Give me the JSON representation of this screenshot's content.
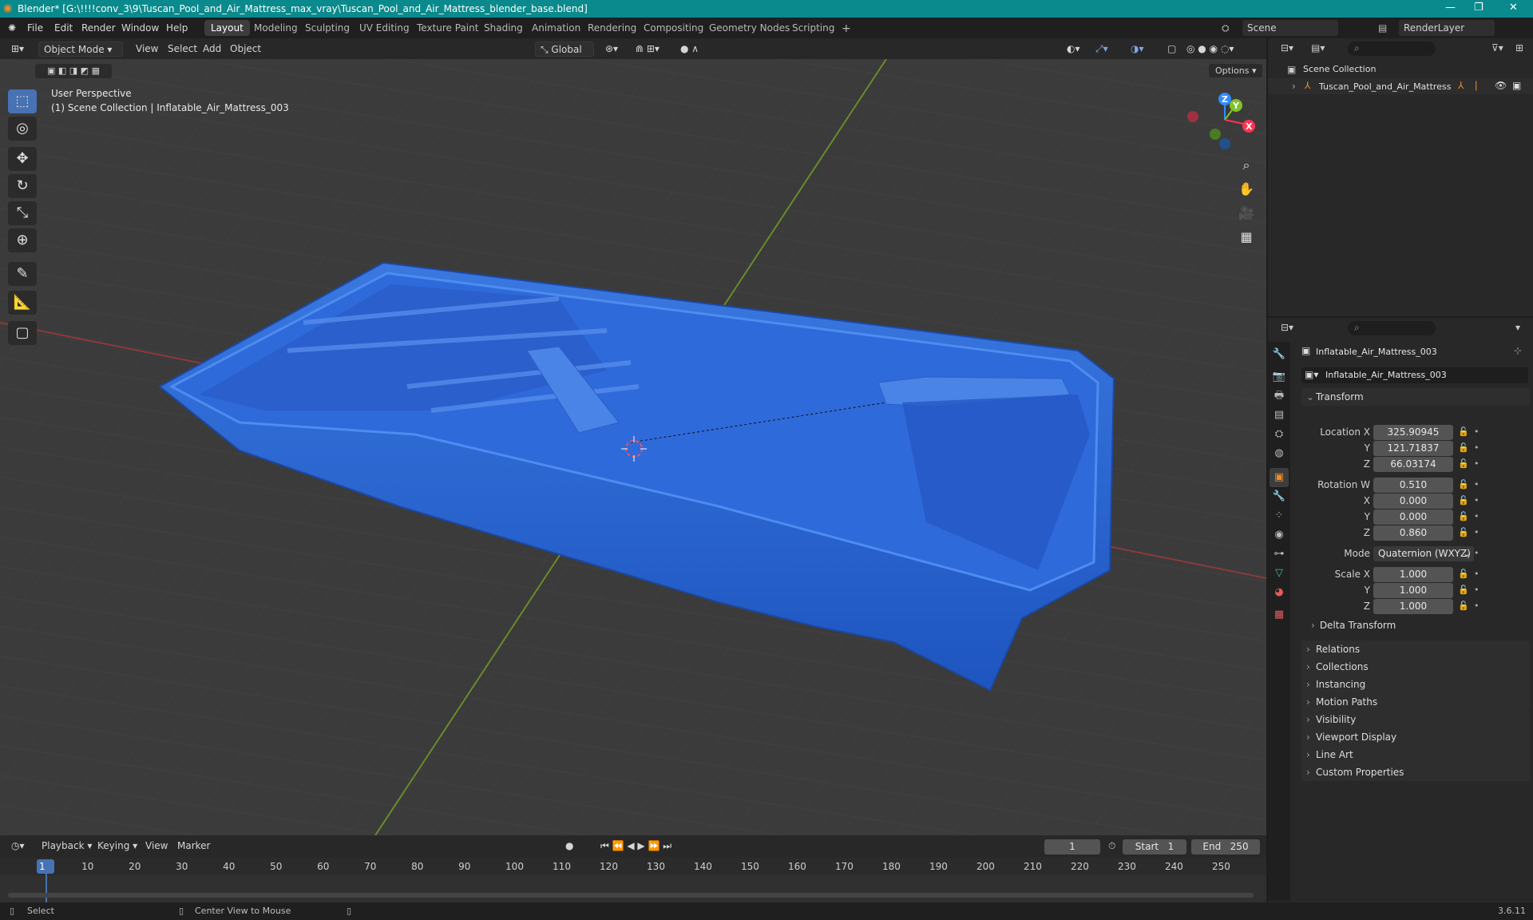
{
  "title_bar": {
    "title": "Blender* [G:\\!!!!conv_3\\9\\Tuscan_Pool_and_Air_Mattress_max_vray\\Tuscan_Pool_and_Air_Mattress_blender_base.blend]"
  },
  "menu": [
    "File",
    "Edit",
    "Render",
    "Window",
    "Help"
  ],
  "workspaces": [
    "Layout",
    "Modeling",
    "Sculpting",
    "UV Editing",
    "Texture Paint",
    "Shading",
    "Animation",
    "Rendering",
    "Compositing",
    "Geometry Nodes",
    "Scripting"
  ],
  "scene": {
    "name": "Scene",
    "render_layer": "RenderLayer"
  },
  "viewport_header": {
    "mode": "Object Mode",
    "menus": [
      "View",
      "Select",
      "Add",
      "Object"
    ],
    "orientation": "Global",
    "options": "Options"
  },
  "viewport": {
    "perspective_label": "User Perspective",
    "collection_label": "(1) Scene Collection | Inflatable_Air_Mattress_003",
    "gizmo_axes": [
      "Z",
      "Y",
      "X"
    ]
  },
  "outliner": {
    "root": "Scene Collection",
    "items": [
      {
        "name": "Tuscan_Pool_and_Air_Mattress"
      }
    ]
  },
  "properties": {
    "object_name": "Inflatable_Air_Mattress_003",
    "datablock_name": "Inflatable_Air_Mattress_003",
    "transform_label": "Transform",
    "location_label": "Location X",
    "location": {
      "x": "325.90945",
      "y": "121.71837",
      "z": "66.03174"
    },
    "rotation_label": "Rotation W",
    "rotation": {
      "w": "0.510",
      "x": "0.000",
      "y": "0.000",
      "z": "0.860"
    },
    "mode_label": "Mode",
    "mode": "Quaternion (WXYZ)",
    "scale_label": "Scale X",
    "scale": {
      "x": "1.000",
      "y": "1.000",
      "z": "1.000"
    },
    "axis_labels": {
      "x": "X",
      "y": "Y",
      "z": "Z"
    },
    "delta_transform": "Delta Transform",
    "panels": [
      "Relations",
      "Collections",
      "Instancing",
      "Motion Paths",
      "Visibility",
      "Viewport Display",
      "Line Art",
      "Custom Properties"
    ]
  },
  "timeline": {
    "menus": [
      "Playback",
      "Keying",
      "View",
      "Marker"
    ],
    "current_frame": "1",
    "start_label": "Start",
    "start": "1",
    "end_label": "End",
    "end": "250",
    "ticks": [
      "1",
      "10",
      "20",
      "30",
      "40",
      "50",
      "60",
      "70",
      "80",
      "90",
      "100",
      "110",
      "120",
      "130",
      "140",
      "150",
      "160",
      "170",
      "180",
      "190",
      "200",
      "210",
      "220",
      "230",
      "240",
      "250"
    ]
  },
  "status_bar": {
    "select": "Select",
    "center": "Center View to Mouse",
    "version": "3.6.11"
  },
  "colors": {
    "accent": "#4772b3",
    "titlebar": "#0a8a8c",
    "pool": "#2a66d4"
  }
}
